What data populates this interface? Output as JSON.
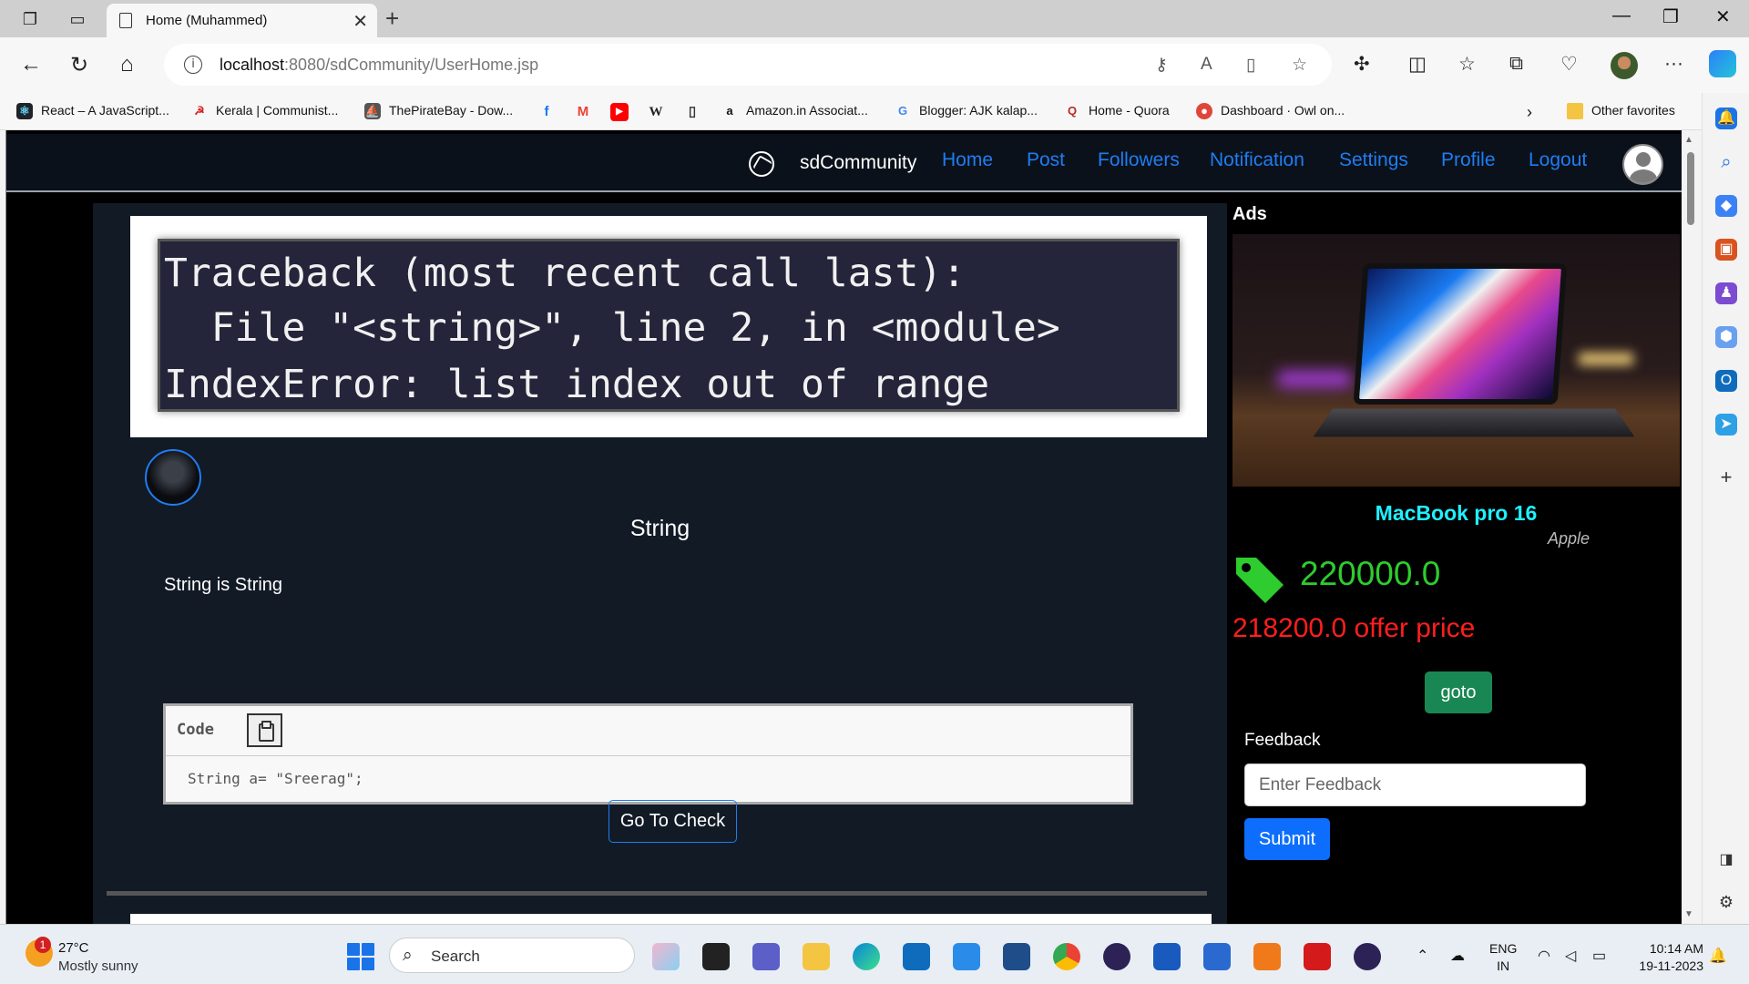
{
  "browser": {
    "tab_title": "Home (Muhammed)",
    "url_host": "localhost",
    "url_rest": ":8080/sdCommunity/UserHome.jsp"
  },
  "favorites": [
    {
      "label": "React – A JavaScript...",
      "color": "#20232a"
    },
    {
      "label": "Kerala | Communist...",
      "color": "#d42020"
    },
    {
      "label": "ThePirateBay - Dow...",
      "color": "#555555"
    },
    {
      "label": "Amazon.in Associat...",
      "color": "#ff9900"
    },
    {
      "label": "Blogger: AJK kalap...",
      "color": "#4285f4"
    },
    {
      "label": "Home - Quora",
      "color": "#b92b27"
    },
    {
      "label": "Dashboard · Owl on...",
      "color": "#e0453a"
    }
  ],
  "favorites_other": "Other favorites",
  "site": {
    "brand": "sdCommunity",
    "nav": [
      "Home",
      "Post",
      "Followers",
      "Notification",
      "Settings",
      "Profile",
      "Logout"
    ]
  },
  "post": {
    "image_lines": [
      "Traceback (most recent call last):",
      "  File \"<string>\", line 2, in <module>",
      "IndexError: list index out of range"
    ],
    "title": "String",
    "body": "String is String",
    "code_label": "Code",
    "code": "String a= \"Sreerag\";",
    "check_label": "Go To Check"
  },
  "ads": {
    "heading": "Ads",
    "product": "MacBook pro 16",
    "brand": "Apple",
    "price": "220000.0",
    "offer": "218200.0 offer price",
    "goto_label": "goto"
  },
  "feedback": {
    "label": "Feedback",
    "placeholder": "Enter Feedback",
    "submit_label": "Submit"
  },
  "taskbar": {
    "temp": "27°C",
    "weather": "Mostly sunny",
    "weather_badge": "1",
    "search": "Search",
    "lang1": "ENG",
    "lang2": "IN",
    "time": "10:14 AM",
    "date": "19-11-2023"
  }
}
